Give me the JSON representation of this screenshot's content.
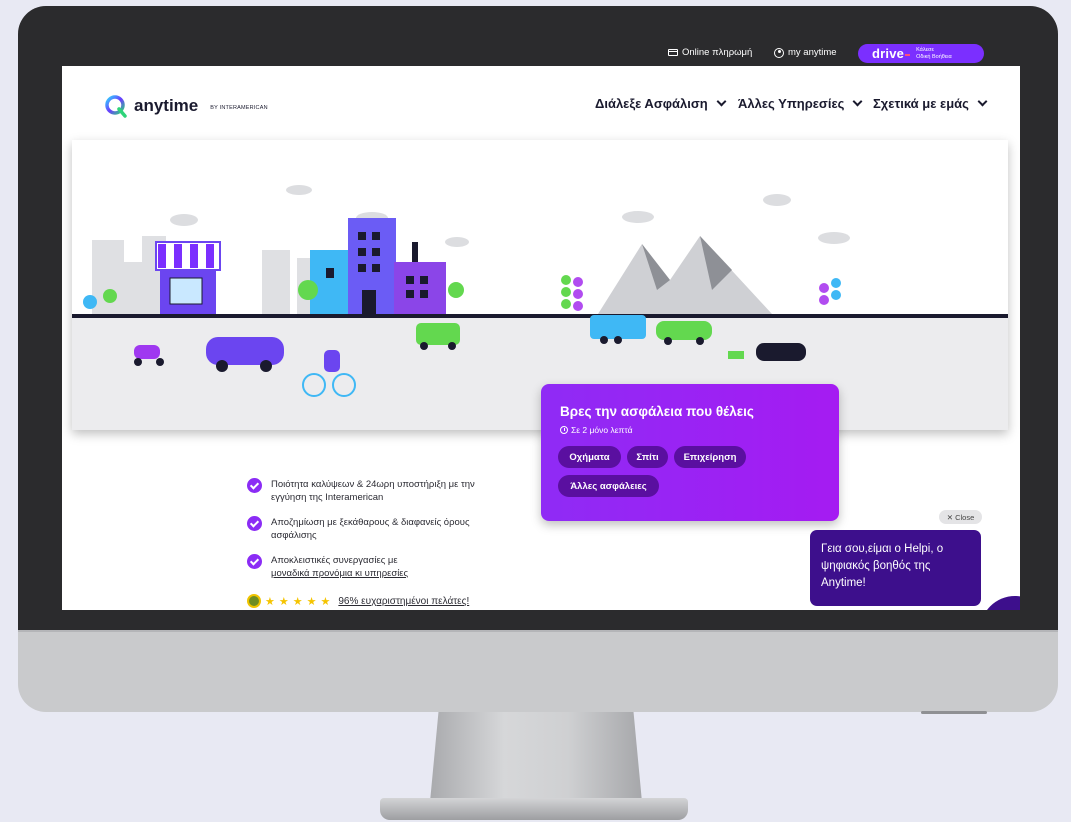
{
  "topbar": {
    "payment": "Online πληρωμή",
    "account": "my anytime",
    "drive": {
      "logo": "drive",
      "line1": "Κάλεσε",
      "line2": "Οδική Βοήθεια"
    }
  },
  "header": {
    "logo_text": "anytime",
    "logo_by": "BY INTERAMERICAN",
    "nav": [
      "Διάλεξε Ασφάλιση",
      "Άλλες Υπηρεσίες",
      "Σχετικά με εμάς"
    ]
  },
  "widget": {
    "title": "Βρες την ασφάλεια που θέλεις",
    "subtitle": "Σε 2 μόνο λεπτά",
    "chips": [
      "Οχήματα",
      "Σπίτι",
      "Επιχείρηση",
      "Άλλες ασφάλειες"
    ]
  },
  "benefits": [
    {
      "line1": "Ποιότητα καλύψεων & 24ωρη υποστήριξη με την",
      "line2": "εγγύηση της Interamerican"
    },
    {
      "line1": "Αποζημίωση με ξεκάθαρους & διαφανείς όρους",
      "line2": "ασφάλισης"
    },
    {
      "line1": "Αποκλειστικές συνεργασίες με",
      "line2": "μοναδικά προνόμια κι υπηρεσίες"
    }
  ],
  "rating": {
    "stars": 5,
    "text": "96% ευχαριστημένοι πελάτες!"
  },
  "chat": {
    "close": "✕ Close",
    "message": "Γεια σου,είμαι ο Helpi, ο ψηφιακός βοηθός της Anytime!"
  },
  "colors": {
    "brand_purple": "#8b2cf5",
    "chat_bg": "#3d0f8c",
    "drive_btn": "#7b2fff"
  }
}
